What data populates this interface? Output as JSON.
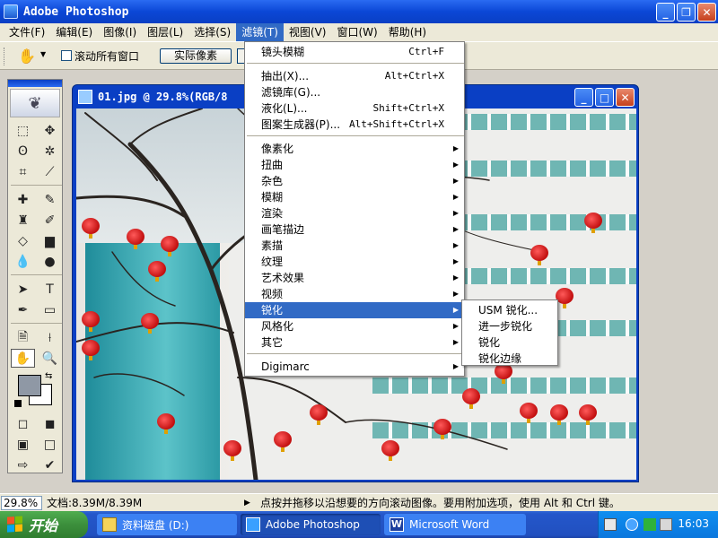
{
  "app": {
    "title": "Adobe Photoshop"
  },
  "menubar": {
    "items": [
      "文件(F)",
      "编辑(E)",
      "图像(I)",
      "图层(L)",
      "选择(S)",
      "滤镜(T)",
      "视图(V)",
      "窗口(W)",
      "帮助(H)"
    ],
    "active_index": 5
  },
  "options": {
    "scroll_all_windows_label": "滚动所有窗口",
    "actual_pixels_label": "实际像素"
  },
  "document": {
    "title": "01.jpg @ 29.8%(RGB/8"
  },
  "filter_menu": {
    "items": [
      {
        "label": "镜头模糊",
        "shortcut": "Ctrl+F"
      },
      {
        "label": "抽出(X)...",
        "shortcut": "Alt+Ctrl+X"
      },
      {
        "label": "滤镜库(G)...",
        "shortcut": ""
      },
      {
        "label": "液化(L)...",
        "shortcut": "Shift+Ctrl+X"
      },
      {
        "label": "图案生成器(P)...",
        "shortcut": "Alt+Shift+Ctrl+X"
      },
      {
        "label": "像素化",
        "submenu": true
      },
      {
        "label": "扭曲",
        "submenu": true
      },
      {
        "label": "杂色",
        "submenu": true
      },
      {
        "label": "模糊",
        "submenu": true
      },
      {
        "label": "渲染",
        "submenu": true
      },
      {
        "label": "画笔描边",
        "submenu": true
      },
      {
        "label": "素描",
        "submenu": true
      },
      {
        "label": "纹理",
        "submenu": true
      },
      {
        "label": "艺术效果",
        "submenu": true
      },
      {
        "label": "视频",
        "submenu": true
      },
      {
        "label": "锐化",
        "submenu": true,
        "highlighted": true
      },
      {
        "label": "风格化",
        "submenu": true
      },
      {
        "label": "其它",
        "submenu": true
      },
      {
        "label": "Digimarc",
        "submenu": true
      }
    ]
  },
  "sharpen_submenu": {
    "items": [
      "USM 锐化...",
      "进一步锐化",
      "锐化",
      "锐化边缘"
    ]
  },
  "colors": {
    "foreground": "#8f98a5",
    "background": "#ffffff",
    "highlight": "#316ac5"
  },
  "statusbar": {
    "zoom": "29.8%",
    "doc_size": "文档:8.39M/8.39M",
    "hint": "点按并拖移以沿想要的方向滚动图像。要用附加选项，使用 Alt 和 Ctrl 键。"
  },
  "taskbar": {
    "start_label": "开始",
    "tasks": [
      "资料磁盘 (D:)",
      "Adobe Photoshop",
      "Microsoft Word"
    ],
    "clock": "16:03"
  }
}
